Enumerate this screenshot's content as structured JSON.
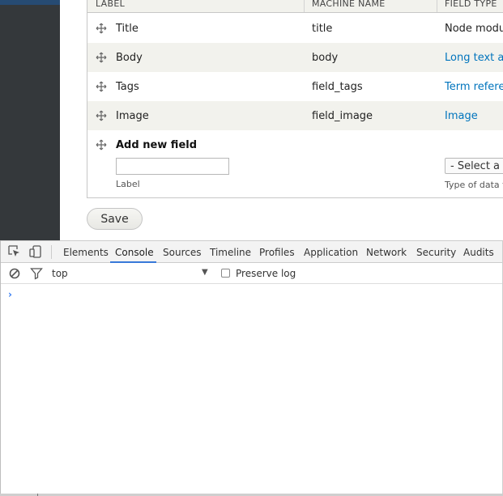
{
  "table": {
    "headers": [
      "LABEL",
      "MACHINE NAME",
      "FIELD TYPE"
    ],
    "rows": [
      {
        "label": "Title",
        "machine_name": "title",
        "field_type": "Node module element",
        "link": false
      },
      {
        "label": "Body",
        "machine_name": "body",
        "field_type": "Long text and summary",
        "link": true
      },
      {
        "label": "Tags",
        "machine_name": "field_tags",
        "field_type": "Term reference",
        "link": true
      },
      {
        "label": "Image",
        "machine_name": "field_image",
        "field_type": "Image",
        "link": true
      }
    ],
    "add_new": {
      "title": "Add new field",
      "label_value": "",
      "label_description": "Label",
      "select_value": "- Select a field type -",
      "type_description": "Type of data to store."
    }
  },
  "save_label": "Save",
  "devtools": {
    "tabs": [
      "Elements",
      "Console",
      "Sources",
      "Timeline",
      "Profiles",
      "Application",
      "Network",
      "Security",
      "Audits"
    ],
    "active_tab": "Console",
    "context": "top",
    "preserve_log_label": "Preserve log",
    "prompt": "›"
  },
  "colors": {
    "link": "#0074bd",
    "active_tab_underline": "#3879d9",
    "sidebar": "#34383b"
  }
}
